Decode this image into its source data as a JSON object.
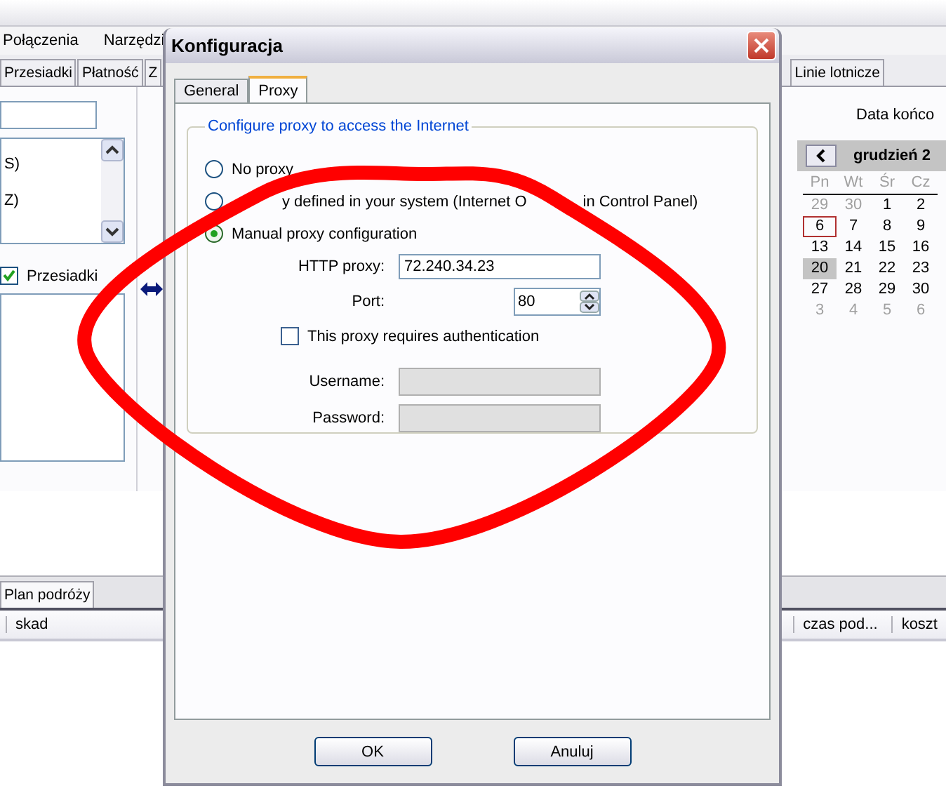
{
  "app": {
    "menu": [
      "Połączenia",
      "Narzędzi"
    ],
    "tabs": [
      "Przesiadki",
      "Płatność",
      "Z",
      "Linie lotnicze"
    ],
    "list_items": [
      "S)",
      "Z)"
    ],
    "transfers_checkbox": {
      "label": "Przesiadki",
      "checked": true
    },
    "end_date_label": "Data końco",
    "calendar": {
      "month": "grudzień 2",
      "weekdays": [
        "Pn",
        "Wt",
        "Śr",
        "Cz"
      ],
      "weeks": [
        [
          {
            "day": "29",
            "outside": true,
            "today": false,
            "selected": false
          },
          {
            "day": "30",
            "outside": true,
            "today": false,
            "selected": false
          },
          {
            "day": "1",
            "outside": false,
            "today": false,
            "selected": false
          },
          {
            "day": "2",
            "outside": false,
            "today": false,
            "selected": false
          }
        ],
        [
          {
            "day": "6",
            "outside": false,
            "today": true,
            "selected": false
          },
          {
            "day": "7",
            "outside": false,
            "today": false,
            "selected": false
          },
          {
            "day": "8",
            "outside": false,
            "today": false,
            "selected": false
          },
          {
            "day": "9",
            "outside": false,
            "today": false,
            "selected": false
          }
        ],
        [
          {
            "day": "13",
            "outside": false,
            "today": false,
            "selected": false
          },
          {
            "day": "14",
            "outside": false,
            "today": false,
            "selected": false
          },
          {
            "day": "15",
            "outside": false,
            "today": false,
            "selected": false
          },
          {
            "day": "16",
            "outside": false,
            "today": false,
            "selected": false
          }
        ],
        [
          {
            "day": "20",
            "outside": false,
            "today": false,
            "selected": true
          },
          {
            "day": "21",
            "outside": false,
            "today": false,
            "selected": false
          },
          {
            "day": "22",
            "outside": false,
            "today": false,
            "selected": false
          },
          {
            "day": "23",
            "outside": false,
            "today": false,
            "selected": false
          }
        ],
        [
          {
            "day": "27",
            "outside": false,
            "today": false,
            "selected": false
          },
          {
            "day": "28",
            "outside": false,
            "today": false,
            "selected": false
          },
          {
            "day": "29",
            "outside": false,
            "today": false,
            "selected": false
          },
          {
            "day": "30",
            "outside": false,
            "today": false,
            "selected": false
          }
        ],
        [
          {
            "day": "3",
            "outside": true,
            "today": false,
            "selected": false
          },
          {
            "day": "4",
            "outside": true,
            "today": false,
            "selected": false
          },
          {
            "day": "5",
            "outside": true,
            "today": false,
            "selected": false
          },
          {
            "day": "6",
            "outside": true,
            "today": false,
            "selected": false
          }
        ]
      ]
    },
    "bottom_tab": "Plan podróży",
    "columns_left": [
      "skad"
    ],
    "columns_right": [
      "czas pod...",
      "koszt"
    ]
  },
  "dialog": {
    "title": "Konfiguracja",
    "tabs": [
      {
        "label": "General",
        "selected": false
      },
      {
        "label": "Proxy",
        "selected": true
      }
    ],
    "group_title": "Configure proxy to access the Internet",
    "radios": [
      {
        "label": "No proxy",
        "selected": false
      },
      {
        "label_parts": [
          "y defined in your system (Internet O",
          "in Control Panel)"
        ],
        "selected": false
      },
      {
        "label": "Manual proxy configuration",
        "selected": true
      }
    ],
    "http_proxy": {
      "label": "HTTP proxy:",
      "value": "72.240.34.23"
    },
    "port": {
      "label": "Port:",
      "value": "80"
    },
    "auth": {
      "label": "This proxy requires authentication",
      "checked": false
    },
    "username": {
      "label": "Username:",
      "disabled": true
    },
    "password": {
      "label": "Password:",
      "disabled": true
    },
    "buttons": [
      "OK",
      "Anuluj"
    ]
  }
}
